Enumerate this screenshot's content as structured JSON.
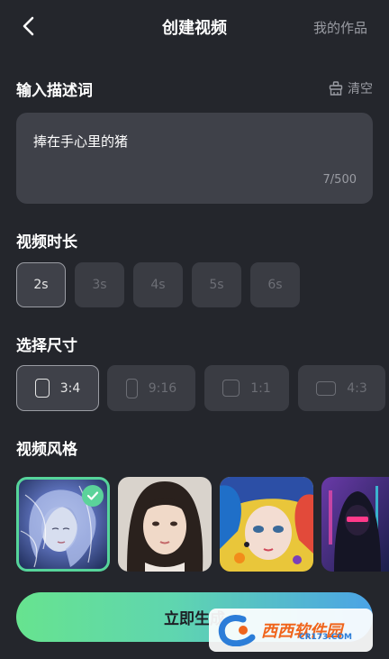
{
  "header": {
    "title": "创建视频",
    "my_works": "我的作品"
  },
  "prompt_section": {
    "title": "输入描述词",
    "clear_label": "清空",
    "prompt_text": "捧在手心里的猪",
    "counter": "7/500"
  },
  "duration_section": {
    "title": "视频时长",
    "options": [
      "2s",
      "3s",
      "4s",
      "5s",
      "6s"
    ],
    "selected": "2s"
  },
  "size_section": {
    "title": "选择尺寸",
    "options": [
      "3:4",
      "9:16",
      "1:1",
      "4:3"
    ],
    "selected": "3:4"
  },
  "style_section": {
    "title": "视频风格",
    "selected_index": 0
  },
  "generate_button": {
    "label": "立即生成"
  },
  "watermark": {
    "brand": "西西软件园",
    "url": "CR173.COM"
  },
  "colors": {
    "accent": "#5bd39a",
    "background": "#24262c",
    "card": "#3f4149"
  }
}
